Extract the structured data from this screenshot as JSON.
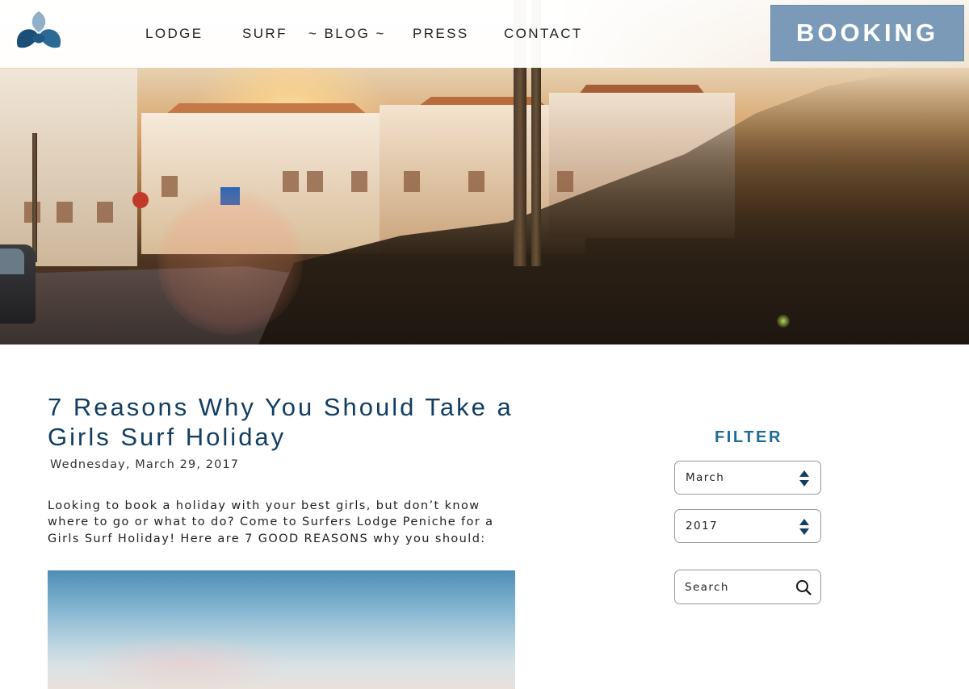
{
  "nav": {
    "items": [
      {
        "label": "LODGE"
      },
      {
        "label": "SURF"
      },
      {
        "label": "~ BLOG ~"
      },
      {
        "label": "PRESS"
      },
      {
        "label": "CONTACT"
      }
    ],
    "booking_label": "BOOKING",
    "logo_icon": "three-leaf-logo-icon"
  },
  "hero": {
    "description_icon": "sunset-street-photo"
  },
  "post": {
    "title": "7 Reasons Why You Should Take a Girls Surf Holiday",
    "date": "Wednesday, March 29, 2017",
    "intro": "Looking to book a holiday with your best girls, but don’t know where to go or what to do? Come to Surfers Lodge Peniche for a Girls Surf Holiday! Here are 7 GOOD REASONS why you should:"
  },
  "sidebar": {
    "filter_title": "FILTER",
    "month_select": {
      "value": "March"
    },
    "year_select": {
      "value": "2017"
    },
    "search": {
      "placeholder": "Search"
    }
  },
  "colors": {
    "booking_bg": "#7a9ab8",
    "title_color": "#123e62",
    "filter_color": "#1d6c96",
    "logo_dark": "#1b4f78",
    "logo_light": "#8fb0c8"
  }
}
